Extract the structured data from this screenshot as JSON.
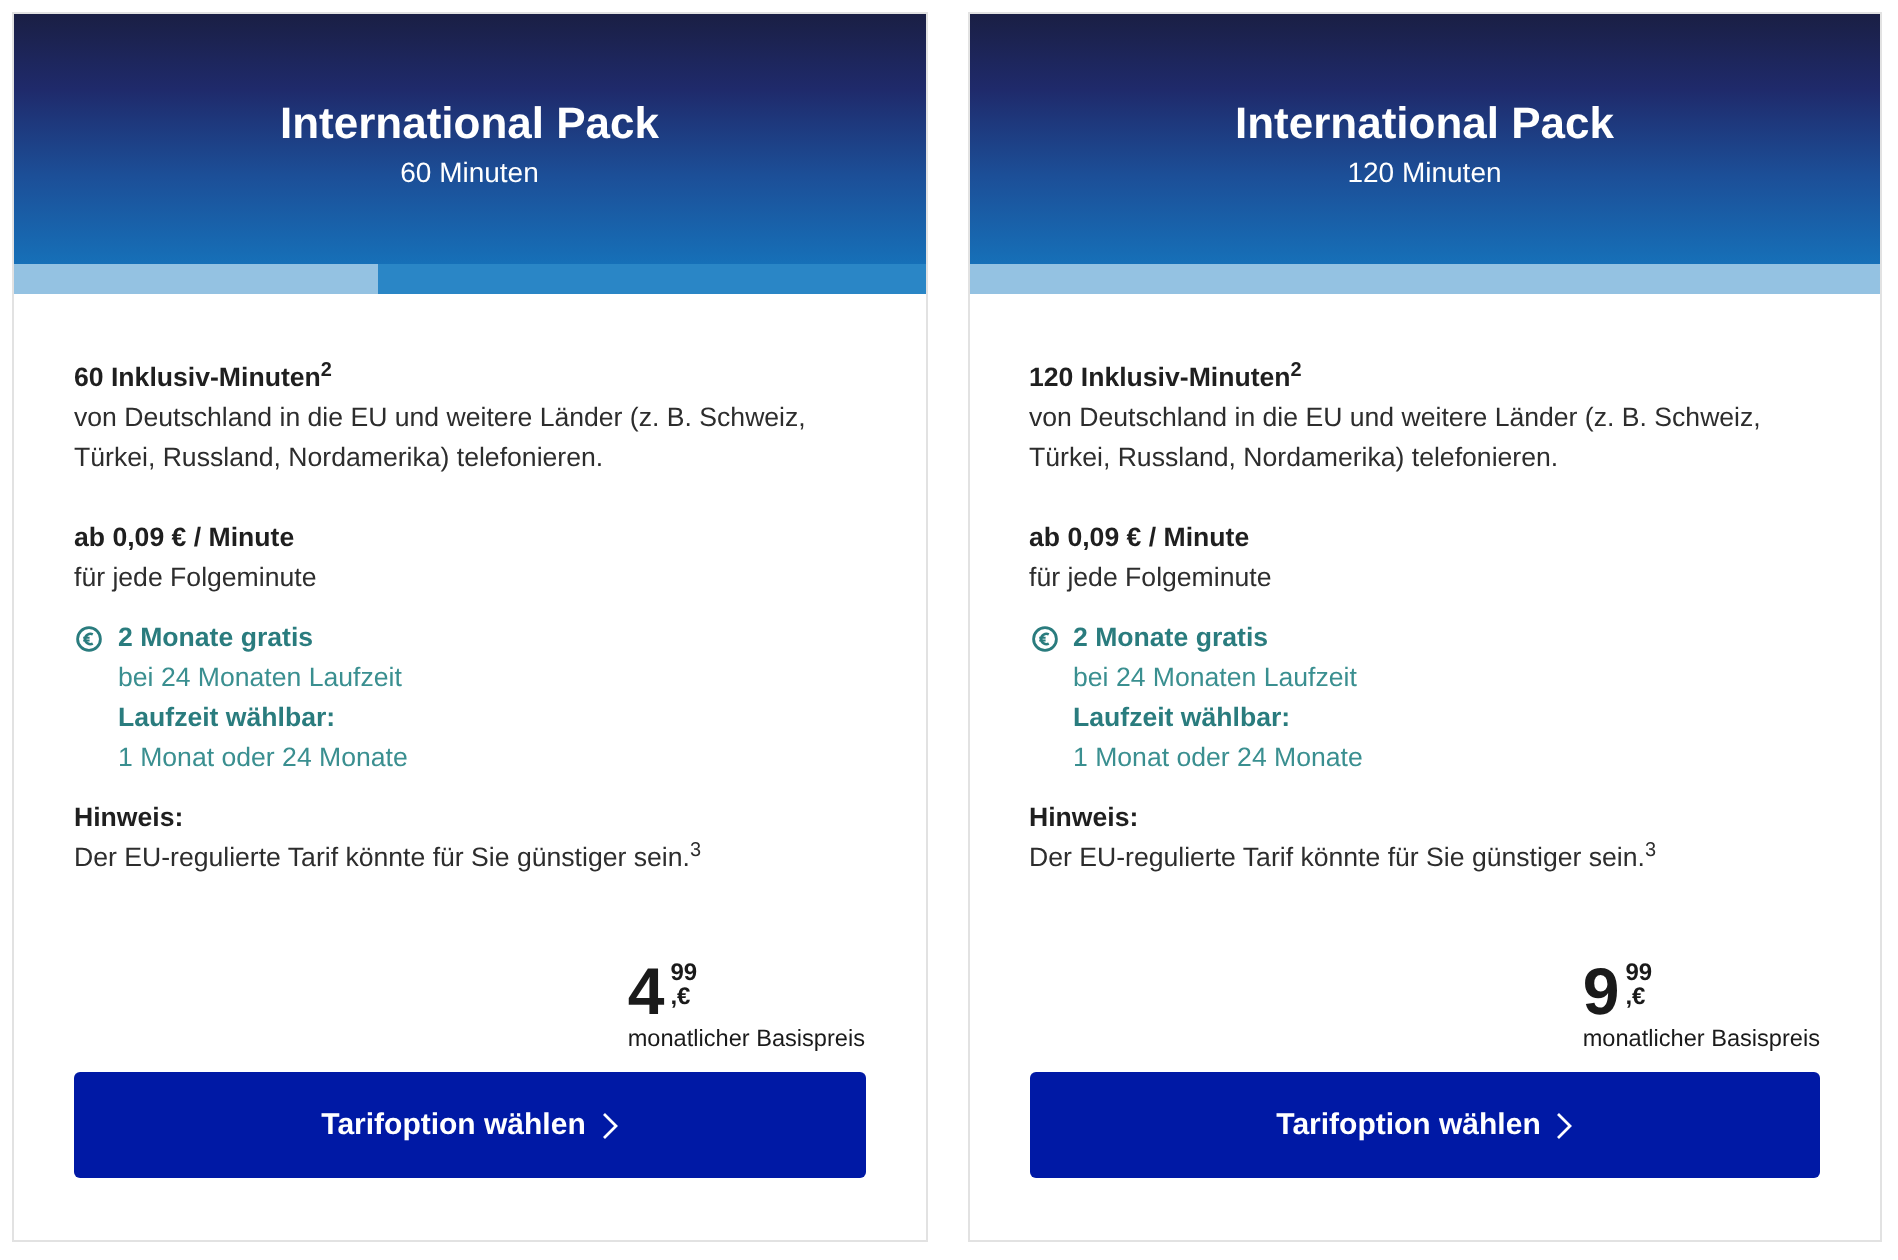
{
  "cards": [
    {
      "title": "International Pack",
      "subtitle": "60 Minuten",
      "band": {
        "level": 0.4
      },
      "minutes": {
        "heading": "60 Inklusiv-Minuten$^{2}$",
        "text": "von Deutschland in die EU und weitere Länder (z. B. Schweiz, Türkei, Russland, Nordamerika) telefonieren."
      },
      "rate": {
        "heading": "ab 0,09 € / Minute",
        "text": "für jede Folgeminute"
      },
      "offer": {
        "heading": "2 Monate gratis",
        "text": "bei 24 Monaten Laufzeit",
        "term_heading": "Laufzeit wählbar:",
        "term_text": "1 Monat oder 24 Monate"
      },
      "notice": {
        "heading": "Hinweis:",
        "text": "Der EU-regulierte Tarif könnte für Sie günstiger sein.$^{3}$"
      },
      "price": {
        "integer": "4",
        "decimals": "99",
        "currency": ",€",
        "caption": "monatlicher Basispreis"
      },
      "button": "Tarifoption wählen"
    },
    {
      "title": "International Pack",
      "subtitle": "120 Minuten",
      "band": {
        "level": 1
      },
      "minutes": {
        "heading": "120 Inklusiv-Minuten$^{2}$",
        "text": "von Deutschland in die EU und weitere Länder (z. B. Schweiz, Türkei, Russland, Nordamerika) telefonieren."
      },
      "rate": {
        "heading": "ab 0,09 € / Minute",
        "text": "für jede Folgeminute"
      },
      "offer": {
        "heading": "2 Monate gratis",
        "text": "bei 24 Monaten Laufzeit",
        "term_heading": "Laufzeit wählbar:",
        "term_text": "1 Monat oder 24 Monate"
      },
      "notice": {
        "heading": "Hinweis:",
        "text": "Der EU-regulierte Tarif könnte für Sie günstiger sein.$^{3}$"
      },
      "price": {
        "integer": "9",
        "decimals": "99",
        "currency": ",€",
        "caption": "monatlicher Basispreis"
      },
      "button": "Tarifoption wählen"
    }
  ]
}
